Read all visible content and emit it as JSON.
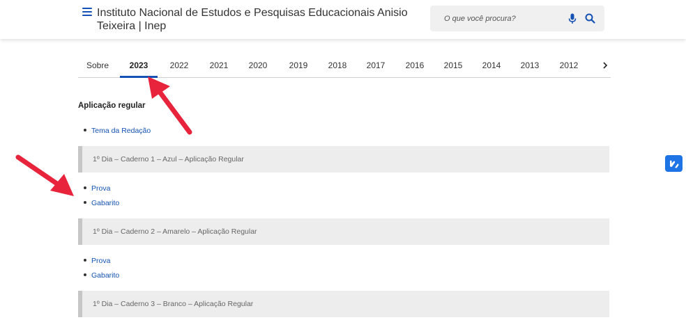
{
  "header": {
    "title": "Instituto Nacional de Estudos e Pesquisas Educacionais Anisio Teixeira | Inep",
    "search": {
      "placeholder": "O que você procura?"
    }
  },
  "tabs": [
    {
      "label": "Sobre",
      "active": false
    },
    {
      "label": "2023",
      "active": true
    },
    {
      "label": "2022",
      "active": false
    },
    {
      "label": "2021",
      "active": false
    },
    {
      "label": "2020",
      "active": false
    },
    {
      "label": "2019",
      "active": false
    },
    {
      "label": "2018",
      "active": false
    },
    {
      "label": "2017",
      "active": false
    },
    {
      "label": "2016",
      "active": false
    },
    {
      "label": "2015",
      "active": false
    },
    {
      "label": "2014",
      "active": false
    },
    {
      "label": "2013",
      "active": false
    },
    {
      "label": "2012",
      "active": false
    }
  ],
  "content": {
    "heading": "Aplicação regular",
    "tema_link": "Tema da Redação",
    "sections": [
      {
        "title": "1º Dia – Caderno 1 – Azul – Aplicação Regular",
        "links": [
          "Prova",
          "Gabarito"
        ]
      },
      {
        "title": "1º Dia – Caderno 2 – Amarelo – Aplicação Regular",
        "links": [
          "Prova",
          "Gabarito"
        ]
      },
      {
        "title": "1º Dia – Caderno 3 – Branco – Aplicação Regular",
        "links": []
      }
    ]
  },
  "icons": {
    "menu": "hamburger-menu-icon",
    "mic": "microphone-icon",
    "search": "search-icon",
    "tab_next": "chevron-right-icon",
    "accessibility": "vlibras-hands-icon"
  },
  "colors": {
    "accent": "#1351b4",
    "annotation_arrow": "#e8243c",
    "accordion_bg": "#ededed",
    "widget": "#1e74e4"
  }
}
